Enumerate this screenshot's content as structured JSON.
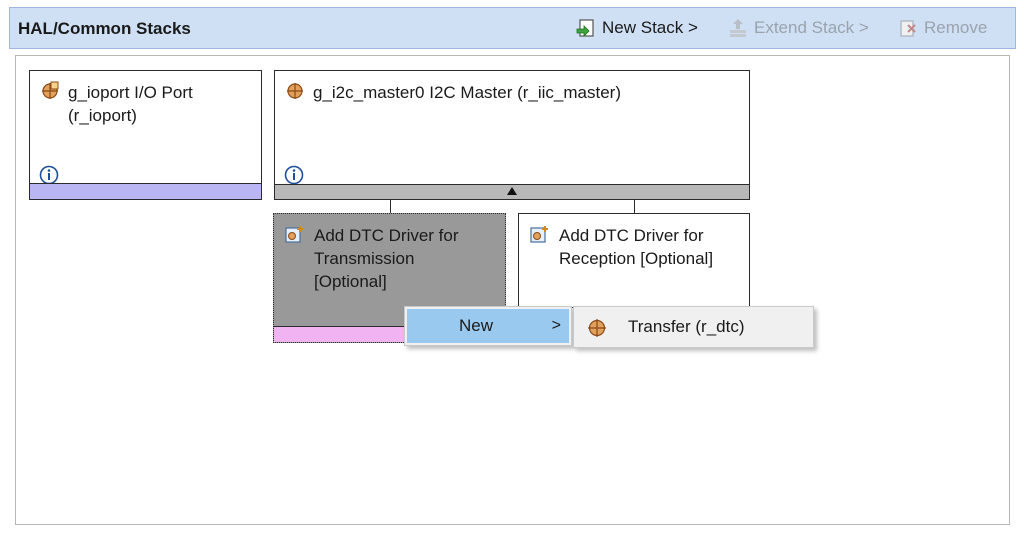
{
  "header": {
    "title": "HAL/Common Stacks",
    "new_stack": "New Stack >",
    "extend_stack": "Extend Stack >",
    "remove": "Remove"
  },
  "modules": {
    "ioport": {
      "label": "g_ioport I/O Port\n(r_ioport)",
      "strip_color": "#b9b6f3"
    },
    "i2c": {
      "label": "g_i2c_master0 I2C Master (r_iic_master)"
    },
    "dtc_tx": {
      "label": "Add DTC Driver for\nTransmission\n[Optional]",
      "fill_color": "#999999",
      "strip_color": "#f1b3f1"
    },
    "dtc_rx": {
      "label": "Add DTC Driver for\nReception [Optional]"
    }
  },
  "context_menu": {
    "new_label": "New",
    "submenu_arrow": ">",
    "transfer_label": "Transfer (r_dtc)"
  },
  "icons": [
    "new-stack-icon",
    "extend-stack-icon",
    "remove-icon",
    "module-icon",
    "info-icon",
    "add-driver-icon",
    "transfer-icon"
  ]
}
